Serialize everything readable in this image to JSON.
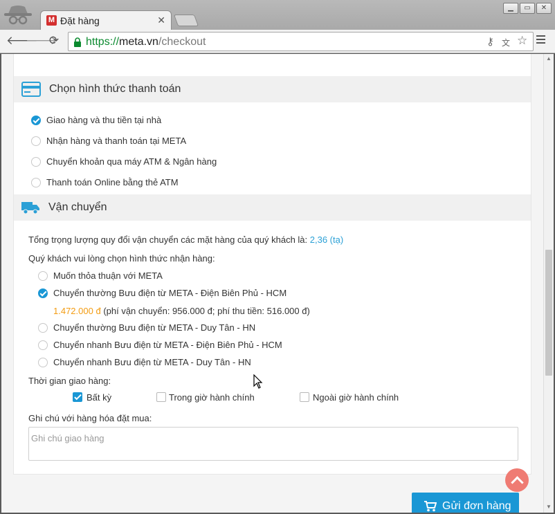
{
  "browser": {
    "tab_title": "Đặt hàng",
    "tab_favicon": "M",
    "url_scheme": "https://",
    "url_host": "meta.vn",
    "url_path": "/checkout"
  },
  "payment": {
    "title": "Chọn hình thức thanh toán",
    "options": [
      {
        "label": "Giao hàng và thu tiền tại nhà",
        "checked": true
      },
      {
        "label": "Nhận hàng và thanh toán tại META",
        "checked": false
      },
      {
        "label": "Chuyển khoản qua máy ATM & Ngân hàng",
        "checked": false
      },
      {
        "label": "Thanh toán Online bằng thẻ ATM",
        "checked": false
      }
    ]
  },
  "shipping": {
    "title": "Vận chuyển",
    "weight_text": "Tổng trọng lượng quy đổi vận chuyển các mặt hàng của quý khách là:",
    "weight_value": "2,36 (tạ)",
    "choose_text": "Quý khách vui lòng chọn hình thức nhận hàng:",
    "options": [
      {
        "label": "Muốn thỏa thuận với META",
        "checked": false
      },
      {
        "label": "Chuyển thường Bưu điện từ META - Điện Biên Phủ - HCM",
        "checked": true
      },
      {
        "label": "Chuyển thường Bưu điện từ META - Duy Tân - HN",
        "checked": false
      },
      {
        "label": "Chuyển nhanh Bưu điện từ META - Điện Biên Phủ - HCM",
        "checked": false
      },
      {
        "label": "Chuyển nhanh Bưu điện từ META - Duy Tân - HN",
        "checked": false
      }
    ],
    "fee_total": "1.472.000 đ",
    "fee_detail": "(phí vận chuyển: 956.000 đ; phí thu tiền: 516.000 đ)",
    "time_label": "Thời gian giao hàng:",
    "time_options": [
      {
        "label": "Bất kỳ",
        "checked": true
      },
      {
        "label": "Trong giờ hành chính",
        "checked": false
      },
      {
        "label": "Ngoài giờ hành chính",
        "checked": false
      }
    ],
    "note_label": "Ghi chú với hàng hóa đặt mua:",
    "note_placeholder": "Ghi chú giao hàng",
    "note_value": ""
  },
  "submit_label": "Gửi đơn hàng",
  "colors": {
    "accent": "#1a97d5",
    "scroll_top_button": "#ef7b73",
    "fee_highlight": "#f39c12"
  }
}
